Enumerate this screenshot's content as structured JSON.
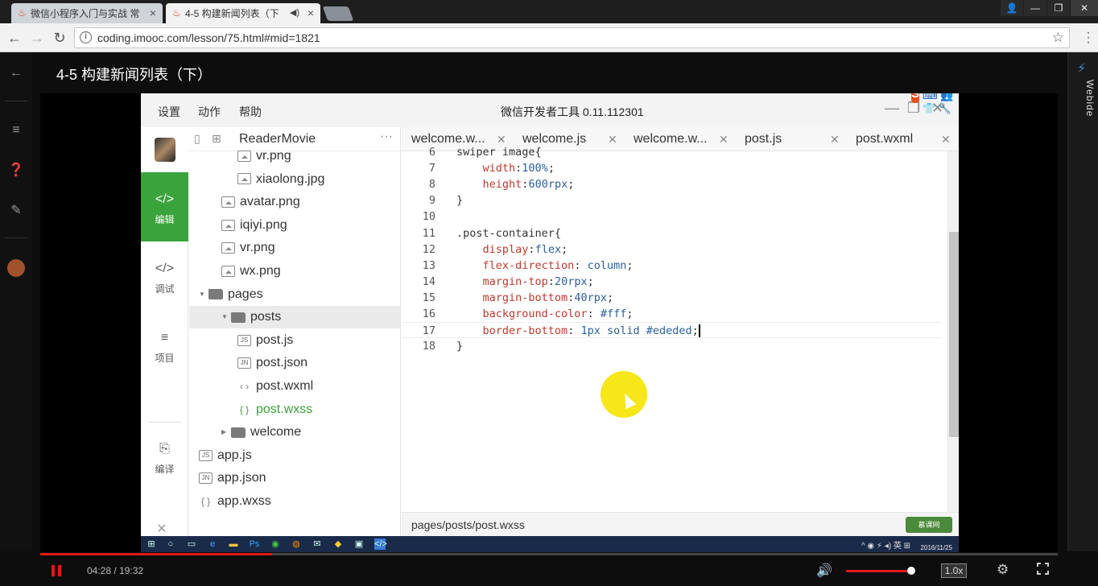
{
  "browser": {
    "tabs": [
      {
        "label": "微信小程序入门与实战 常",
        "close": "×"
      },
      {
        "label": "4-5 构建新闻列表（下",
        "audio": "◀)",
        "close": "×"
      }
    ],
    "url": "coding.imooc.com/lesson/75.html#mid=1821",
    "window_buttons": [
      "👤",
      "—",
      "❐",
      "✕"
    ]
  },
  "page": {
    "lesson_title": "4-5 构建新闻列表（下）",
    "right_panel_label": "Webide"
  },
  "ide": {
    "menu": [
      "设置",
      "动作",
      "帮助"
    ],
    "title": "微信开发者工具 0.11.112301",
    "ime_label": "S",
    "ime_glyphs": "中 ☽ °, ⌨ 👥 👕 🔧",
    "sidebar": [
      {
        "icon": "</>",
        "label": "编辑",
        "active": true
      },
      {
        "icon": "</>",
        "label": "调试",
        "active": false
      },
      {
        "icon": "≡",
        "label": "项目",
        "active": false
      },
      {
        "icon": "⎘",
        "label": "编译",
        "active": false
      }
    ],
    "close_glyph": "×",
    "project_name": "ReaderMovie",
    "tree": [
      {
        "label": "vr.png",
        "kind": "img",
        "indent": 2
      },
      {
        "label": "xiaolong.jpg",
        "kind": "img",
        "indent": 2
      },
      {
        "label": "avatar.png",
        "kind": "img",
        "indent": 1
      },
      {
        "label": "iqiyi.png",
        "kind": "img",
        "indent": 1
      },
      {
        "label": "vr.png",
        "kind": "img",
        "indent": 1
      },
      {
        "label": "wx.png",
        "kind": "img",
        "indent": 1
      },
      {
        "label": "pages",
        "kind": "folder-open",
        "indent": 0
      },
      {
        "label": "posts",
        "kind": "folder-open",
        "indent": 1,
        "selected": true
      },
      {
        "label": "post.js",
        "kind": "JS",
        "indent": 2
      },
      {
        "label": "post.json",
        "kind": "JN",
        "indent": 2
      },
      {
        "label": "post.wxml",
        "kind": "<>",
        "indent": 2
      },
      {
        "label": "post.wxss",
        "kind": "{}",
        "indent": 2,
        "active": true
      },
      {
        "label": "welcome",
        "kind": "folder-closed",
        "indent": 1
      },
      {
        "label": "app.js",
        "kind": "JS",
        "indent": 0
      },
      {
        "label": "app.json",
        "kind": "JN",
        "indent": 0
      },
      {
        "label": "app.wxss",
        "kind": "{}",
        "indent": 0
      }
    ],
    "editor_tabs": [
      "welcome.w...",
      "welcome.js",
      "welcome.w...",
      "post.js",
      "post.wxml"
    ],
    "code_lines": [
      {
        "n": "6",
        "html": "swiper image{"
      },
      {
        "n": "7",
        "html": "    <span class='k'>width</span>:<span class='v'>100%</span>;"
      },
      {
        "n": "8",
        "html": "    <span class='k'>height</span>:<span class='v'>600rpx</span>;"
      },
      {
        "n": "9",
        "html": "}"
      },
      {
        "n": "10",
        "html": ""
      },
      {
        "n": "11",
        "html": ".post-container{"
      },
      {
        "n": "12",
        "html": "    <span class='k'>display</span>:<span class='v'>flex</span>;"
      },
      {
        "n": "13",
        "html": "    <span class='k'>flex-direction</span>: <span class='v'>column</span>;"
      },
      {
        "n": "14",
        "html": "    <span class='k'>margin-top</span>:<span class='v'>20rpx</span>;"
      },
      {
        "n": "15",
        "html": "    <span class='k'>margin-bottom</span>:<span class='v'>40rpx</span>;"
      },
      {
        "n": "16",
        "html": "    <span class='k'>background-color</span>: <span class='v'>#fff</span>;"
      },
      {
        "n": "17",
        "html": "    <span class='k'>border-bottom</span>: <span class='v'>1px solid #ededed</span>;<span class='caret'></span>",
        "current": true
      },
      {
        "n": "18",
        "html": "}"
      }
    ],
    "status_path": "pages/posts/post.wxss",
    "watermark": "慕课网"
  },
  "taskbar": {
    "clock_time": "",
    "clock_date": "2016/11/25"
  },
  "player": {
    "time": "04:28 / 19:32",
    "progress": 0.228,
    "volume": 0.95,
    "speed": "1.0x"
  }
}
